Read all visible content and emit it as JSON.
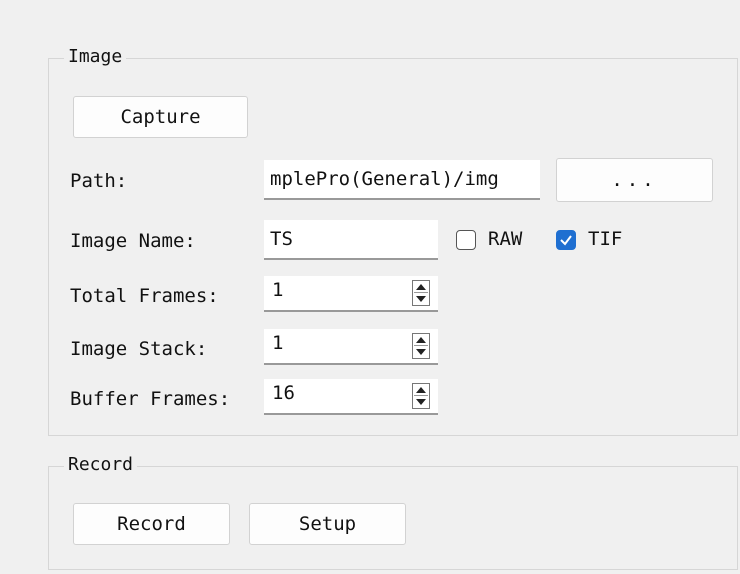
{
  "image_group": {
    "title": "Image",
    "capture_label": "Capture",
    "path_label": "Path:",
    "path_value": "mplePro(General)/img",
    "browse_label": "...",
    "image_name_label": "Image Name:",
    "image_name_value": "TS",
    "raw_label": "RAW",
    "raw_checked": false,
    "tif_label": "TIF",
    "tif_checked": true,
    "total_frames_label": "Total Frames:",
    "total_frames_value": "1",
    "image_stack_label": "Image Stack:",
    "image_stack_value": "1",
    "buffer_frames_label": "Buffer Frames:",
    "buffer_frames_value": "16"
  },
  "record_group": {
    "title": "Record",
    "record_label": "Record",
    "setup_label": "Setup"
  },
  "colors": {
    "accent": "#1f6fd1",
    "background": "#f0f0f0"
  }
}
